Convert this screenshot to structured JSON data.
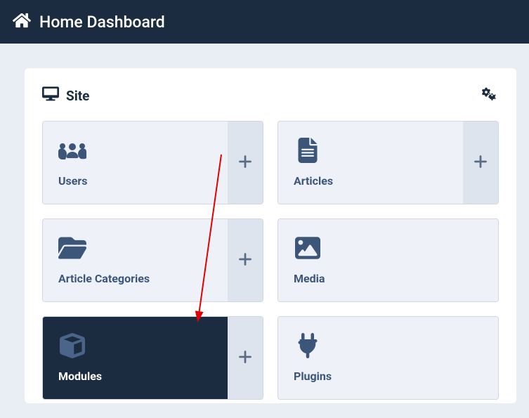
{
  "header": {
    "title": "Home Dashboard"
  },
  "panel": {
    "title": "Site"
  },
  "tiles": {
    "users": {
      "label": "Users"
    },
    "articles": {
      "label": "Articles"
    },
    "categories": {
      "label": "Article Categories"
    },
    "media": {
      "label": "Media"
    },
    "modules": {
      "label": "Modules"
    },
    "plugins": {
      "label": "Plugins"
    }
  },
  "colors": {
    "header_bg": "#1c2c40",
    "body_bg": "#e9eef5",
    "tile_bg": "#eef2f8",
    "tile_side": "#dde4ee",
    "icon": "#3c567a"
  }
}
